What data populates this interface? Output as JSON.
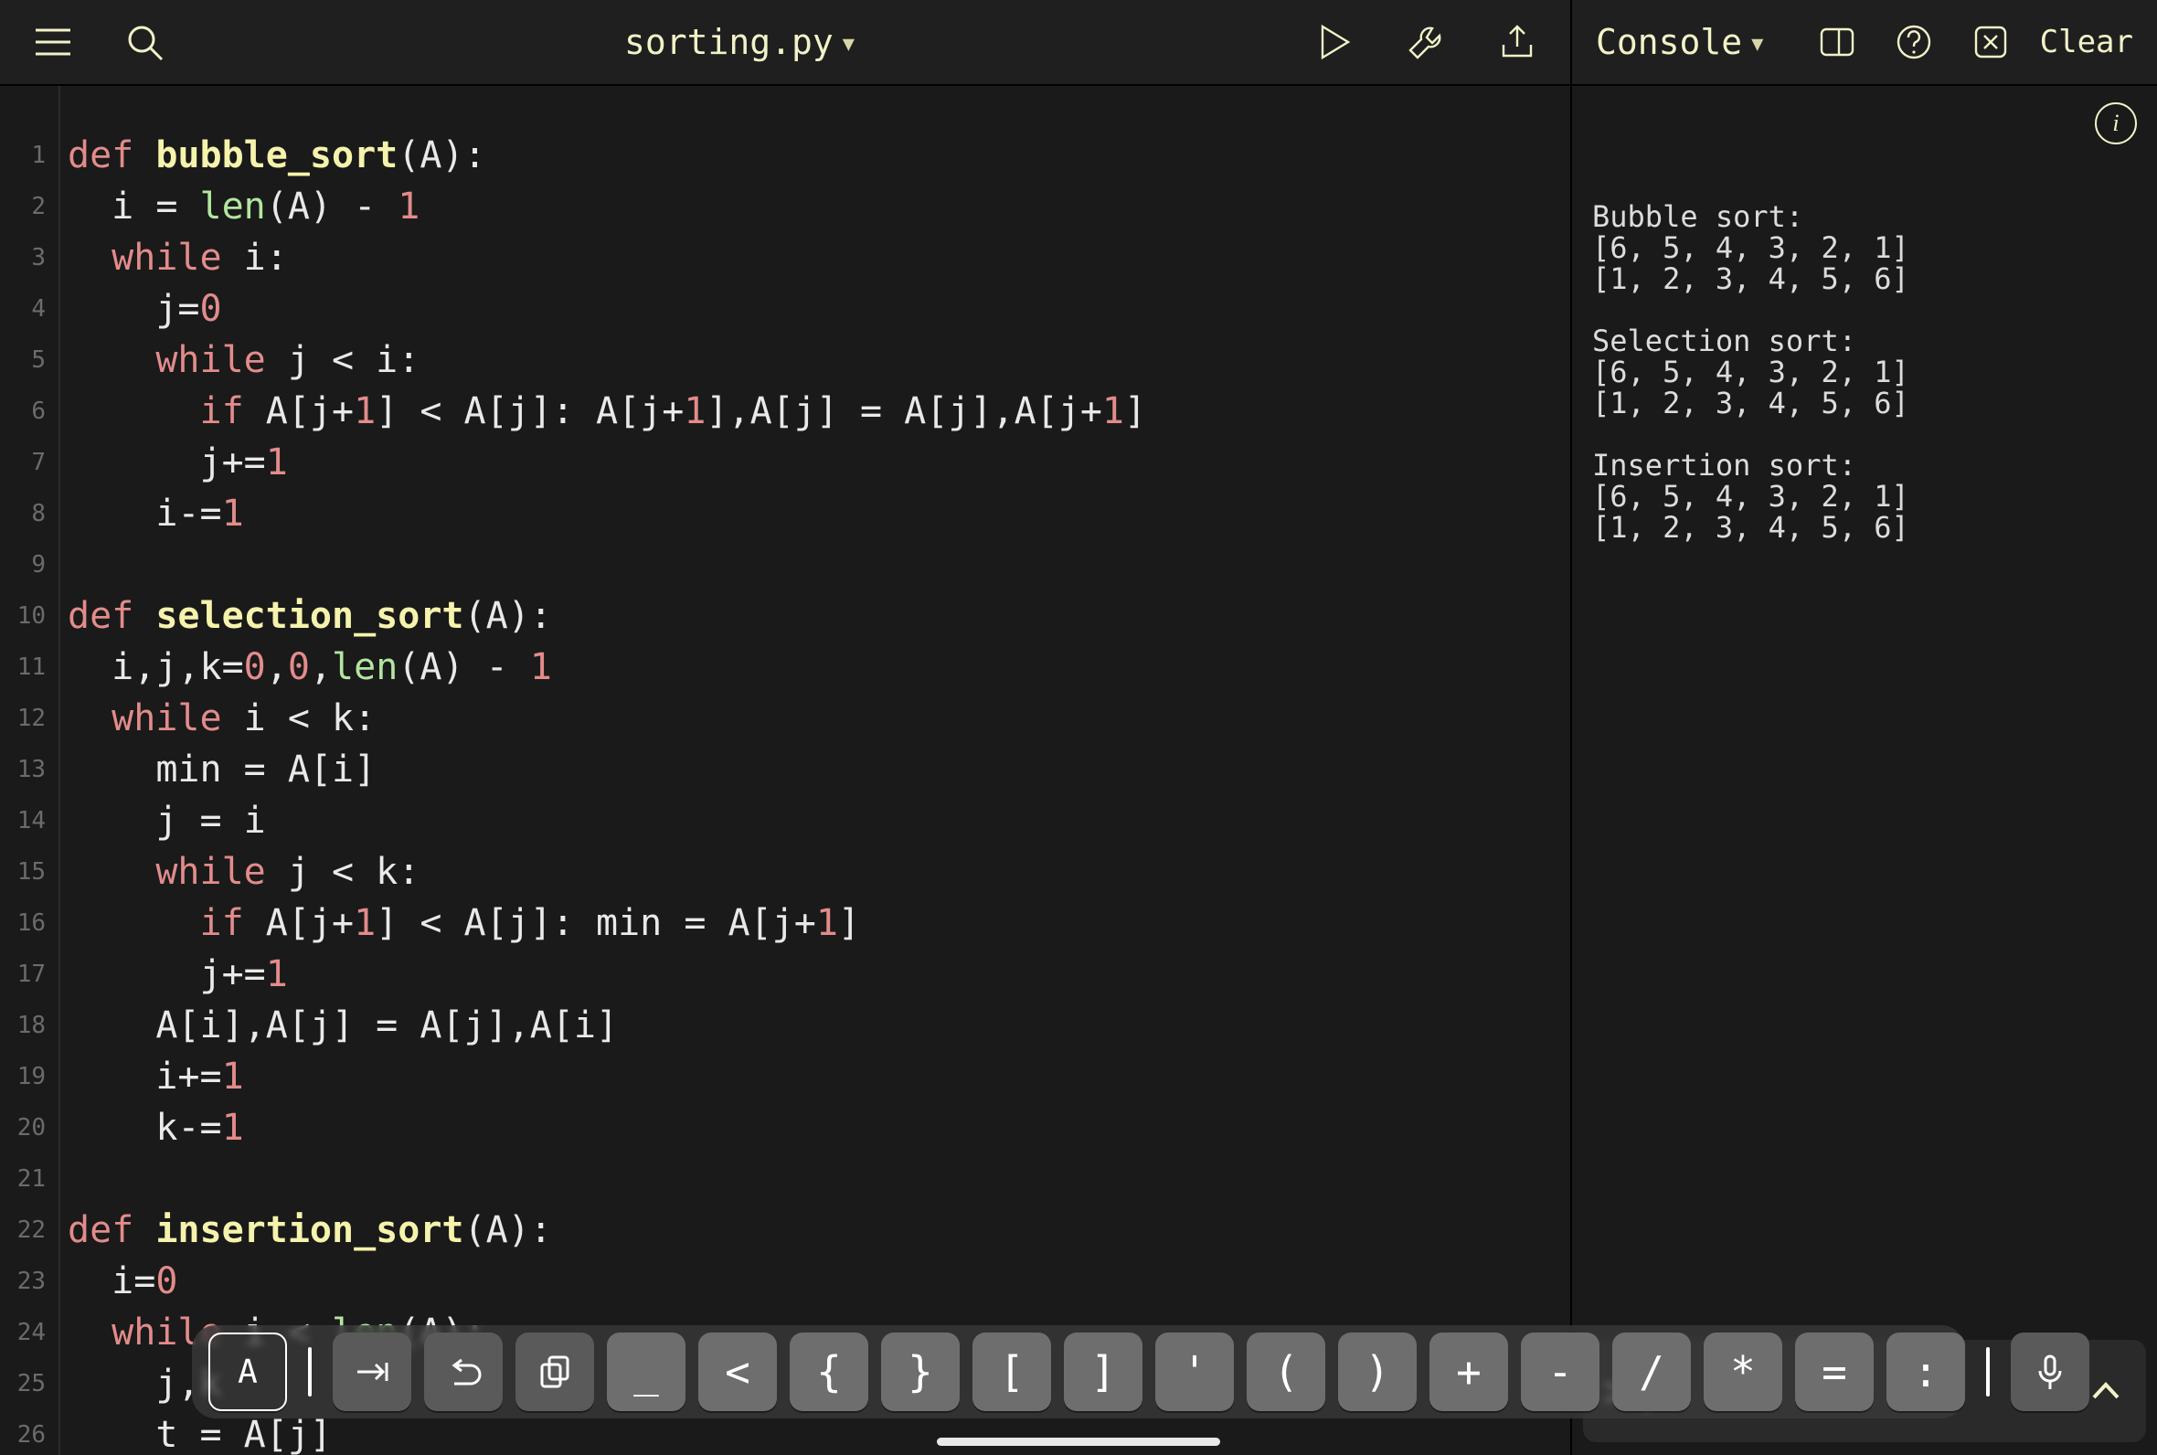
{
  "editor": {
    "file_name": "sorting.py",
    "lines": [
      [
        [
          "kw",
          "def "
        ],
        [
          "fn",
          "bubble_sort"
        ],
        [
          "plain",
          "(A):"
        ]
      ],
      [
        [
          "plain",
          "  i = "
        ],
        [
          "builtin",
          "len"
        ],
        [
          "plain",
          "(A) - "
        ],
        [
          "num",
          "1"
        ]
      ],
      [
        [
          "plain",
          "  "
        ],
        [
          "kw",
          "while"
        ],
        [
          "plain",
          " i:"
        ]
      ],
      [
        [
          "plain",
          "    j="
        ],
        [
          "num",
          "0"
        ]
      ],
      [
        [
          "plain",
          "    "
        ],
        [
          "kw",
          "while"
        ],
        [
          "plain",
          " j < i:"
        ]
      ],
      [
        [
          "plain",
          "      "
        ],
        [
          "kw",
          "if"
        ],
        [
          "plain",
          " A[j+"
        ],
        [
          "num",
          "1"
        ],
        [
          "plain",
          "] < A[j]: A[j+"
        ],
        [
          "num",
          "1"
        ],
        [
          "plain",
          "],A[j] = A[j],A[j+"
        ],
        [
          "num",
          "1"
        ],
        [
          "plain",
          "]"
        ]
      ],
      [
        [
          "plain",
          "      j+="
        ],
        [
          "num",
          "1"
        ]
      ],
      [
        [
          "plain",
          "    i-="
        ],
        [
          "num",
          "1"
        ]
      ],
      [
        [
          "plain",
          ""
        ]
      ],
      [
        [
          "kw",
          "def "
        ],
        [
          "fn",
          "selection_sort"
        ],
        [
          "plain",
          "(A):"
        ]
      ],
      [
        [
          "plain",
          "  i,j,k="
        ],
        [
          "num",
          "0"
        ],
        [
          "plain",
          ","
        ],
        [
          "num",
          "0"
        ],
        [
          "plain",
          ","
        ],
        [
          "builtin",
          "len"
        ],
        [
          "plain",
          "(A) - "
        ],
        [
          "num",
          "1"
        ]
      ],
      [
        [
          "plain",
          "  "
        ],
        [
          "kw",
          "while"
        ],
        [
          "plain",
          " i < k:"
        ]
      ],
      [
        [
          "plain",
          "    min = A[i]"
        ]
      ],
      [
        [
          "plain",
          "    j = i"
        ]
      ],
      [
        [
          "plain",
          "    "
        ],
        [
          "kw",
          "while"
        ],
        [
          "plain",
          " j < k:"
        ]
      ],
      [
        [
          "plain",
          "      "
        ],
        [
          "kw",
          "if"
        ],
        [
          "plain",
          " A[j+"
        ],
        [
          "num",
          "1"
        ],
        [
          "plain",
          "] < A[j]: min = A[j+"
        ],
        [
          "num",
          "1"
        ],
        [
          "plain",
          "]"
        ]
      ],
      [
        [
          "plain",
          "      j+="
        ],
        [
          "num",
          "1"
        ]
      ],
      [
        [
          "plain",
          "    A[i],A[j] = A[j],A[i]"
        ]
      ],
      [
        [
          "plain",
          "    i+="
        ],
        [
          "num",
          "1"
        ]
      ],
      [
        [
          "plain",
          "    k-="
        ],
        [
          "num",
          "1"
        ]
      ],
      [
        [
          "plain",
          ""
        ]
      ],
      [
        [
          "kw",
          "def "
        ],
        [
          "fn",
          "insertion_sort"
        ],
        [
          "plain",
          "(A):"
        ]
      ],
      [
        [
          "plain",
          "  i="
        ],
        [
          "num",
          "0"
        ]
      ],
      [
        [
          "plain",
          "  "
        ],
        [
          "kw",
          "while"
        ],
        [
          "plain",
          " i < "
        ],
        [
          "builtin",
          "len"
        ],
        [
          "plain",
          "(A):"
        ]
      ],
      [
        [
          "plain",
          "    j,k"
        ]
      ],
      [
        [
          "plain",
          "    t = A[j]"
        ]
      ]
    ]
  },
  "console": {
    "title": "Console",
    "clear_label": "Clear",
    "output": "Bubble sort:\n[6, 5, 4, 3, 2, 1]\n[1, 2, 3, 4, 5, 6]\n\nSelection sort:\n[6, 5, 4, 3, 2, 1]\n[1, 2, 3, 4, 5, 6]\n\nInsertion sort:\n[6, 5, 4, 3, 2, 1]\n[1, 2, 3, 4, 5, 6]",
    "prompt": ">"
  },
  "keyboard": {
    "keys": [
      "_",
      "<",
      "{",
      "}",
      "[",
      "]",
      "'",
      "(",
      ")",
      "+",
      "-",
      "/",
      "*",
      "=",
      ":"
    ]
  },
  "icons": {
    "info": "i"
  }
}
